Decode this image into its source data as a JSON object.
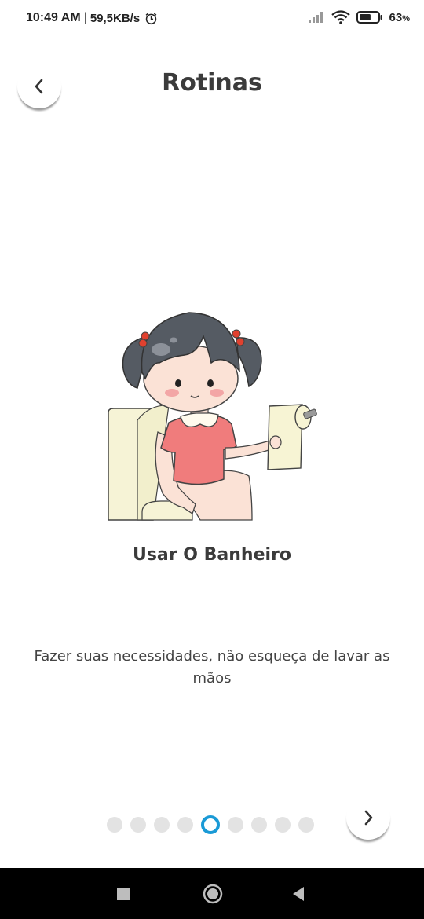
{
  "status_bar": {
    "time": "10:49 AM",
    "separator": "|",
    "speed": "59,5KB/s",
    "battery_percent": "63",
    "battery_percent_sign": "%",
    "battery_level": 0.63,
    "icons": [
      "alarm-icon",
      "signal-icon",
      "wifi-icon",
      "battery-icon"
    ]
  },
  "header": {
    "title": "Rotinas",
    "back_icon": "chevron-left-icon"
  },
  "routine": {
    "illustration_icon": "girl-on-toilet-illustration",
    "title": "Usar O Banheiro",
    "description": "Fazer suas necessidades, não esqueça de lavar as mãos"
  },
  "pagination": {
    "total": 9,
    "current_index": 4,
    "active_color": "#1a9ad6",
    "inactive_color": "#e3e3e3",
    "next_icon": "chevron-right-icon"
  },
  "nav_bar": {
    "icons": [
      "recent-apps-icon",
      "home-icon",
      "back-triangle-icon"
    ]
  }
}
